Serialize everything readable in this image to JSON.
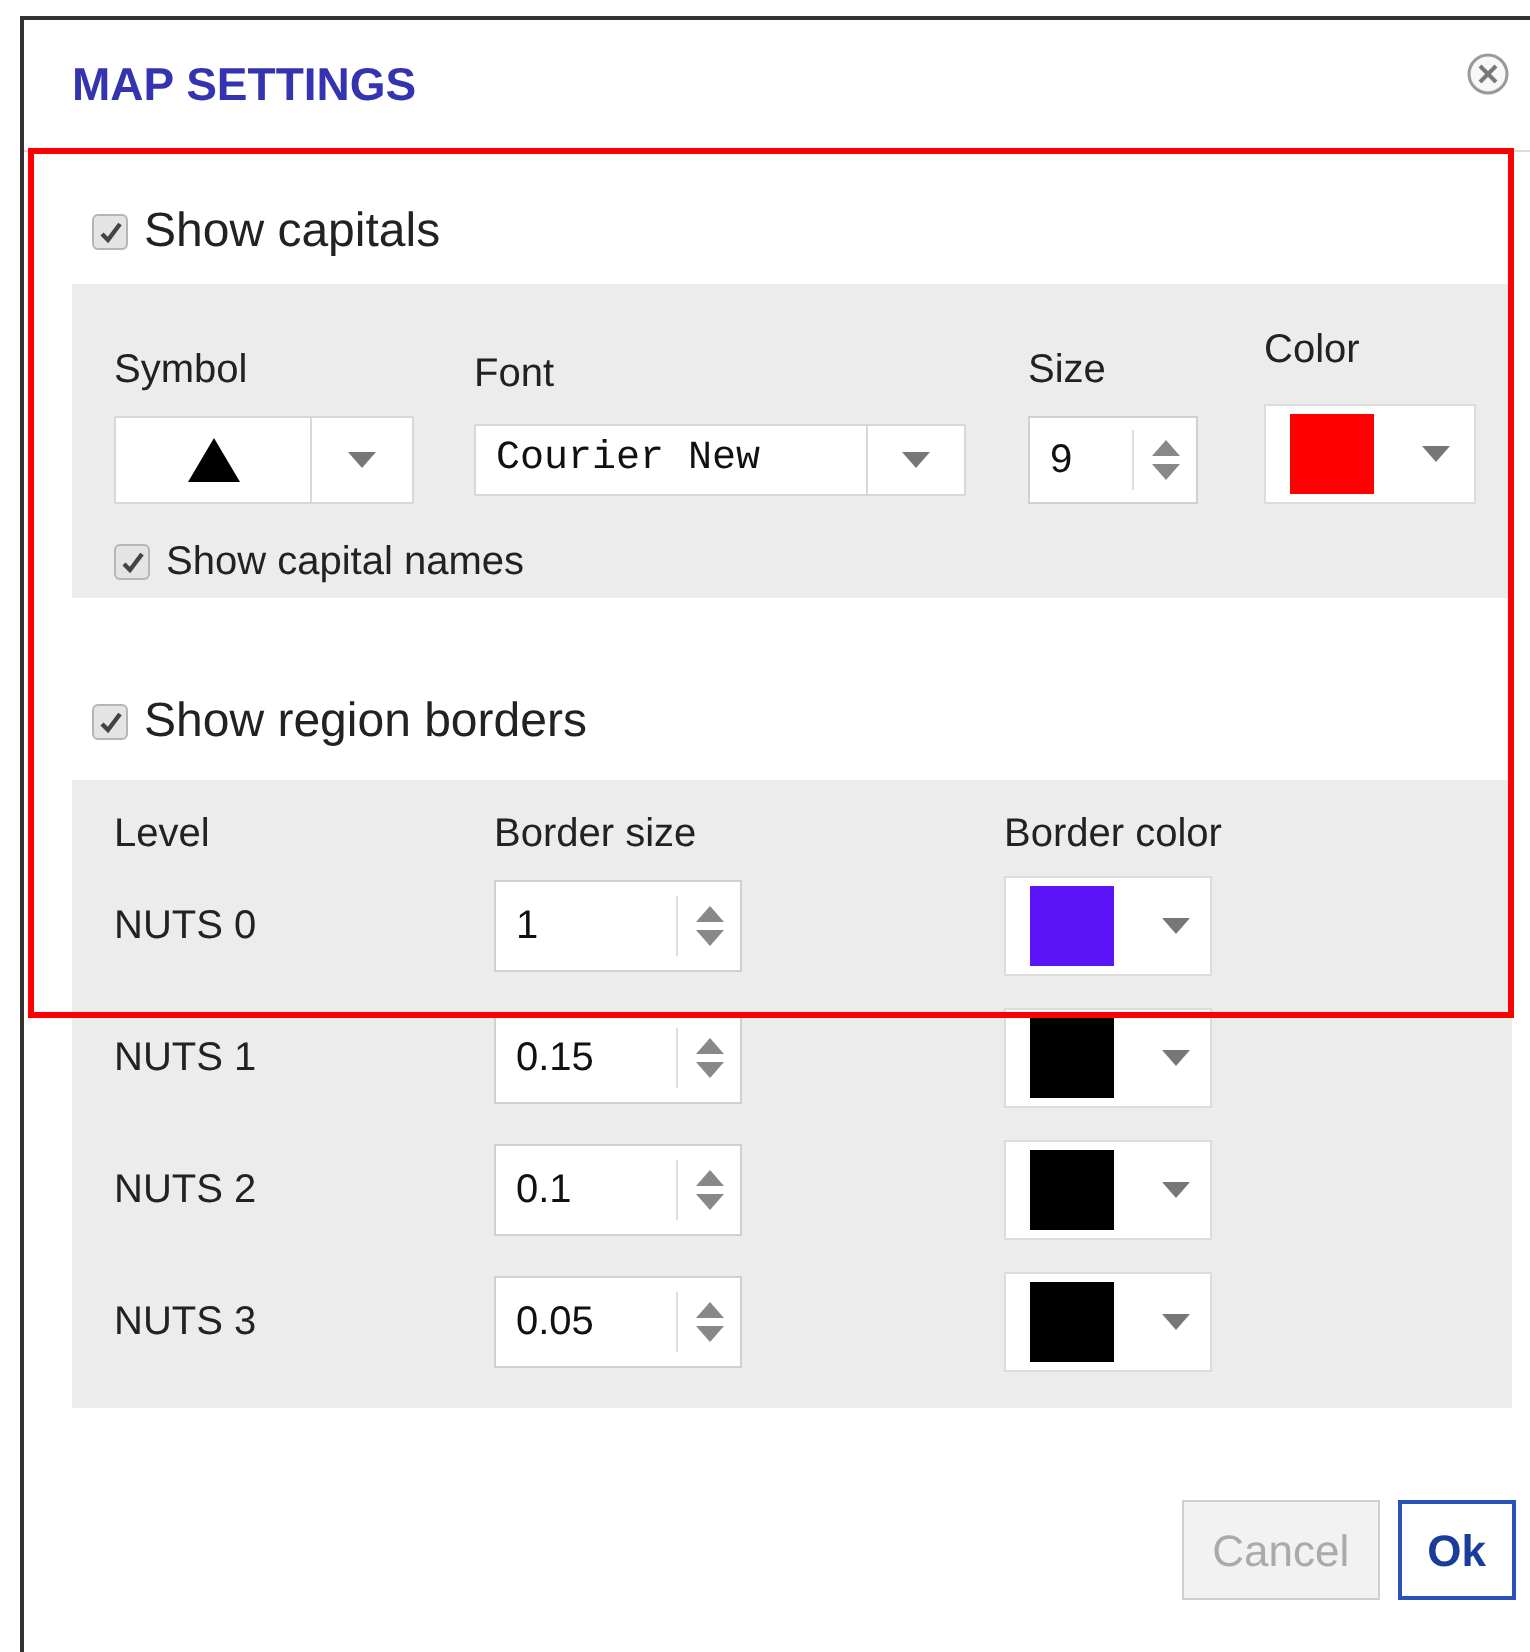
{
  "dialog": {
    "title": "MAP SETTINGS"
  },
  "capitals": {
    "label": "Show capitals",
    "checked": true,
    "columns": [
      "Symbol",
      "Font",
      "Size",
      "Color"
    ],
    "font": "Courier New",
    "size": "9",
    "color": "#ff0000",
    "show_names": {
      "label": "Show capital names",
      "checked": true
    }
  },
  "borders": {
    "label": "Show region borders",
    "checked": true,
    "columns": [
      "Level",
      "Border size",
      "Border color"
    ],
    "rows": [
      {
        "level": "NUTS 0",
        "size": "1",
        "color": "#5a14f5"
      },
      {
        "level": "NUTS 1",
        "size": "0.15",
        "color": "#000000"
      },
      {
        "level": "NUTS 2",
        "size": "0.1",
        "color": "#000000"
      },
      {
        "level": "NUTS 3",
        "size": "0.05",
        "color": "#000000"
      }
    ]
  },
  "buttons": [
    {
      "label": "Cancel",
      "disabled": true
    },
    {
      "label": "Ok",
      "disabled": false
    }
  ]
}
